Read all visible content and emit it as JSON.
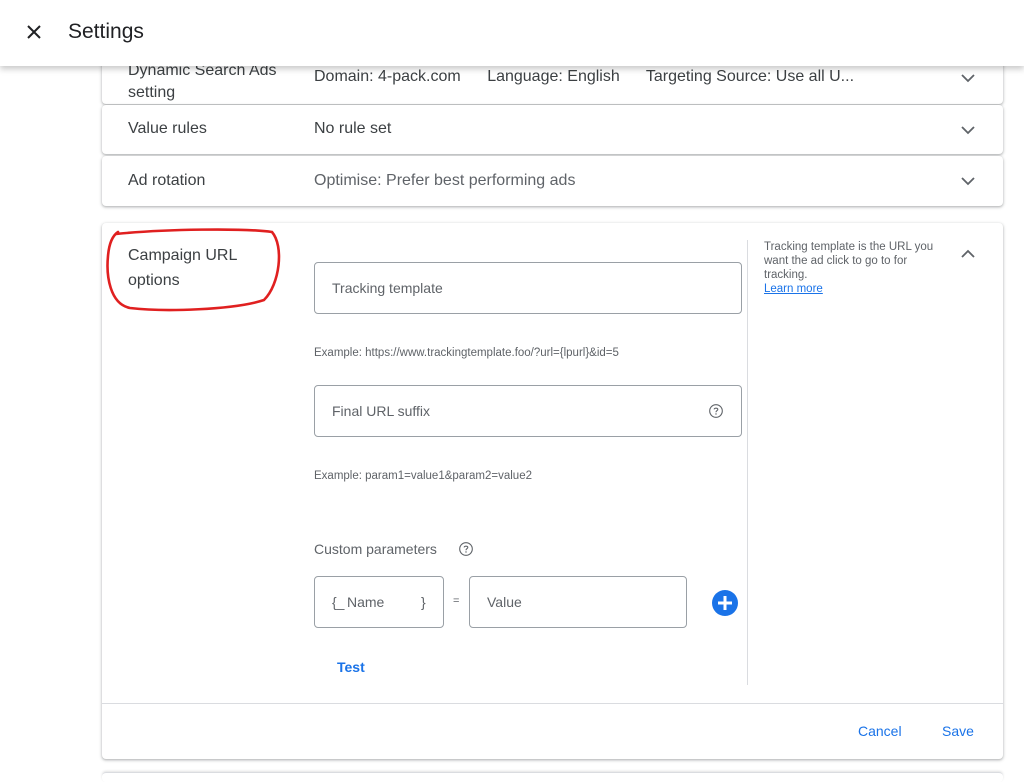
{
  "header": {
    "title": "Settings",
    "close_icon": "close-icon"
  },
  "collapsed_rows": [
    {
      "label_line1": "Dynamic Search Ads",
      "label_line2": "setting",
      "summary": [
        {
          "key": "Domain: ",
          "value": "4-pack.com"
        },
        {
          "key": "Language: ",
          "value": "English"
        },
        {
          "key": "Targeting Source: ",
          "value": "Use all U..."
        }
      ],
      "icon": "chevron-down-icon"
    },
    {
      "label": "Value rules",
      "summary": "No rule set",
      "icon": "chevron-down-icon"
    },
    {
      "label": "Ad rotation",
      "summary": "Optimise: Prefer best performing ads",
      "icon": "chevron-down-icon"
    }
  ],
  "expanded_section": {
    "label_line1": "Campaign URL",
    "label_line2": "options",
    "tracking_template": {
      "placeholder": "Tracking template",
      "value": "",
      "example": "Example: https://www.trackingtemplate.foo/?url={lpurl}&id=5"
    },
    "final_url_suffix": {
      "placeholder": "Final URL suffix",
      "value": "",
      "example": "Example: param1=value1&param2=value2",
      "help_icon": "help-circle-icon"
    },
    "custom_parameters": {
      "label": "Custom parameters",
      "help_icon": "help-circle-icon",
      "name_prefix": "{_",
      "name_placeholder": "Name",
      "name_suffix": "}",
      "equals": "=",
      "value_placeholder": "Value",
      "add_icon": "add-circle-icon"
    },
    "test_label": "Test",
    "side_help": {
      "text": "Tracking template is the URL you want the ad click to go to for tracking.",
      "link": "Learn more"
    },
    "collapse_icon": "chevron-up-icon",
    "cancel_label": "Cancel",
    "save_label": "Save"
  },
  "colors": {
    "accent": "#1a73e8",
    "annotation": "#e02020",
    "text": "#3c4043",
    "muted": "#5f6368"
  }
}
